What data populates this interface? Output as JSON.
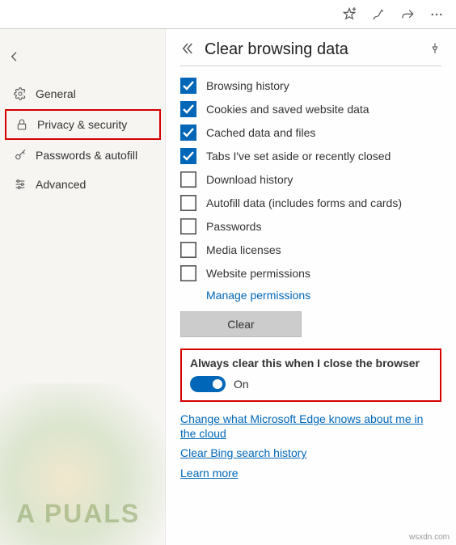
{
  "toolbar": {
    "icons": [
      "star-add-icon",
      "draw-icon",
      "share-icon",
      "more-icon"
    ]
  },
  "sidebar": {
    "items": [
      {
        "icon": "gear-icon",
        "label": "General"
      },
      {
        "icon": "lock-icon",
        "label": "Privacy & security"
      },
      {
        "icon": "key-icon",
        "label": "Passwords & autofill"
      },
      {
        "icon": "sliders-icon",
        "label": "Advanced"
      }
    ],
    "active_index": 1
  },
  "panel": {
    "title": "Clear browsing data",
    "checkboxes": [
      {
        "checked": true,
        "label": "Browsing history"
      },
      {
        "checked": true,
        "label": "Cookies and saved website data"
      },
      {
        "checked": true,
        "label": "Cached data and files"
      },
      {
        "checked": true,
        "label": "Tabs I've set aside or recently closed"
      },
      {
        "checked": false,
        "label": "Download history"
      },
      {
        "checked": false,
        "label": "Autofill data (includes forms and cards)"
      },
      {
        "checked": false,
        "label": "Passwords"
      },
      {
        "checked": false,
        "label": "Media licenses"
      },
      {
        "checked": false,
        "label": "Website permissions"
      }
    ],
    "manage_permissions_link": "Manage permissions",
    "clear_button": "Clear",
    "always_clear": {
      "heading": "Always clear this when I close the browser",
      "state": "On",
      "enabled": true
    },
    "links": [
      "Change what Microsoft Edge knows about me in the cloud",
      "Clear Bing search history",
      "Learn more"
    ]
  },
  "watermark_left": "A  PUALS",
  "watermark_right": "wsxdn.com"
}
